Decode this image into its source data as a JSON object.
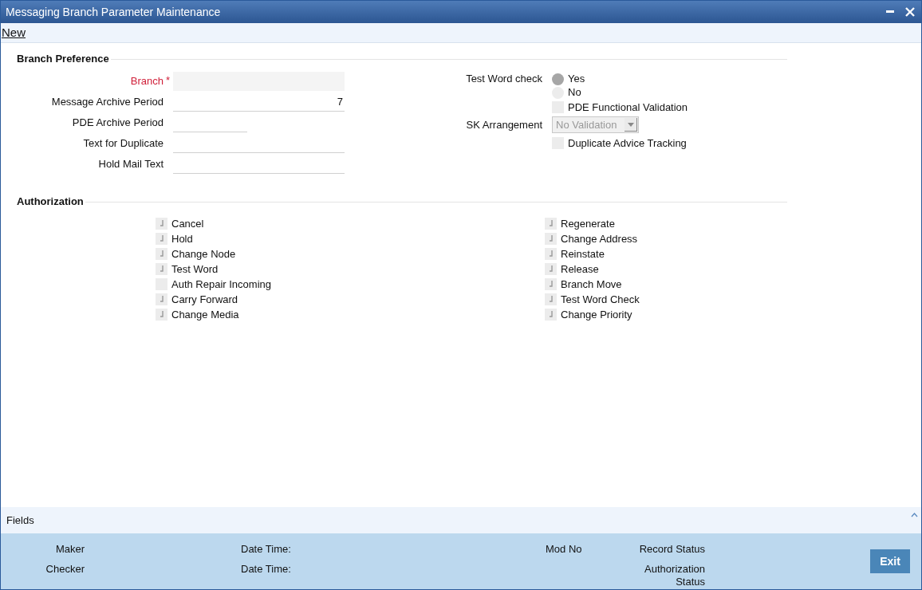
{
  "window": {
    "title": "Messaging Branch Parameter Maintenance"
  },
  "toolbar": {
    "new_link": "New"
  },
  "branch_preference": {
    "heading": "Branch Preference",
    "fields": [
      {
        "label": "Branch",
        "required": true,
        "required_mark": "*",
        "disabled": true
      },
      {
        "label": "Message Archive Period",
        "required": false,
        "value": "7",
        "disabled": false
      },
      {
        "label": "PDE Archive Period",
        "required": false,
        "disabled": false,
        "short": true
      },
      {
        "label": "Text for Duplicate",
        "required": false,
        "disabled": false
      },
      {
        "label": "Hold Mail Text",
        "required": false,
        "disabled": false
      }
    ],
    "test_word_check": {
      "label": "Test Word check",
      "options": [
        {
          "label": "Yes",
          "selected": true
        },
        {
          "label": "No",
          "selected": false
        }
      ]
    },
    "pde_functional_validation": {
      "label": "PDE Functional Validation",
      "checked": false
    },
    "sk_arrangement": {
      "label": "SK Arrangement",
      "value": "No Validation",
      "disabled": true
    },
    "duplicate_advice_tracking": {
      "label": "Duplicate Advice Tracking",
      "checked": false
    }
  },
  "authorization": {
    "heading": "Authorization",
    "left": [
      {
        "label": "Cancel",
        "checked": true
      },
      {
        "label": "Hold",
        "checked": true
      },
      {
        "label": "Change Node",
        "checked": true
      },
      {
        "label": "Test Word",
        "checked": true
      },
      {
        "label": "Auth Repair Incoming",
        "checked": false
      },
      {
        "label": "Carry Forward",
        "checked": true
      },
      {
        "label": "Change Media",
        "checked": true
      }
    ],
    "right": [
      {
        "label": "Regenerate",
        "checked": true
      },
      {
        "label": "Change Address",
        "checked": true
      },
      {
        "label": "Reinstate",
        "checked": true
      },
      {
        "label": "Release",
        "checked": true
      },
      {
        "label": "Branch Move",
        "checked": true
      },
      {
        "label": "Test Word Check",
        "checked": true
      },
      {
        "label": "Change Priority",
        "checked": true
      }
    ]
  },
  "fields_bar": {
    "label": "Fields"
  },
  "audit": {
    "maker": "Maker",
    "maker_date": "Date Time:",
    "mod_no": "Mod No",
    "record_status": "Record Status",
    "checker": "Checker",
    "checker_date": "Date Time:",
    "authorization_status": "Authorization Status"
  },
  "buttons": [
    {
      "label": "Exit"
    }
  ]
}
